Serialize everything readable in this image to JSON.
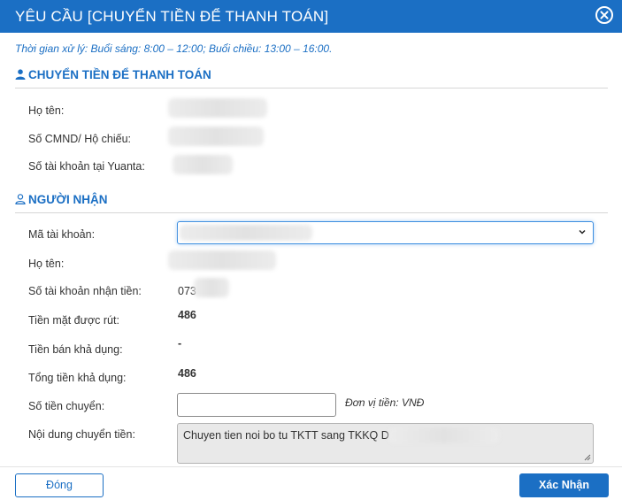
{
  "dialog": {
    "title": "YÊU CẦU [CHUYỂN TIỀN ĐỂ THANH TOÁN]",
    "notice": "Thời gian xử lý: Buổi sáng: 8:00 – 12:00; Buổi chiều: 13:00 – 16:00."
  },
  "sender": {
    "heading": "CHUYỂN TIỀN ĐỂ THANH TOÁN",
    "name_label": "Họ tên:",
    "id_label": "Số CMND/ Hộ chiếu:",
    "account_label": "Số tài khoản tại Yuanta:"
  },
  "recipient": {
    "heading": "NGƯỜI NHẬN",
    "account_code_label": "Mã tài khoản:",
    "name_label": "Họ tên:",
    "receive_account_label": "Số tài khoản nhận tiền:",
    "receive_account_value": "073",
    "cash_withdrawable_label": "Tiền mặt được rút:",
    "cash_withdrawable_value": "486",
    "sale_available_label": "Tiền bán khả dụng:",
    "sale_available_value": "-",
    "total_available_label": "Tổng tiền khả dụng:",
    "total_available_value": "486",
    "amount_label": "Số tiền chuyển:",
    "amount_value": "",
    "unit_text": "Đơn vị tiền: VNĐ",
    "content_label": "Nội dung chuyển tiền:",
    "content_value": "Chuyen tien noi bo tu TKTT sang TKKQ D"
  },
  "footer": {
    "close_label": "Đóng",
    "submit_label": "Xác Nhận"
  },
  "colors": {
    "primary": "#1b6fc4",
    "input_border_focus": "#3d8ee0",
    "readonly_bg": "#e9e9e9"
  },
  "icons": [
    "close-circle-icon",
    "user-solid-icon",
    "user-outline-icon",
    "chevron-down-icon",
    "resize-handle-icon"
  ]
}
